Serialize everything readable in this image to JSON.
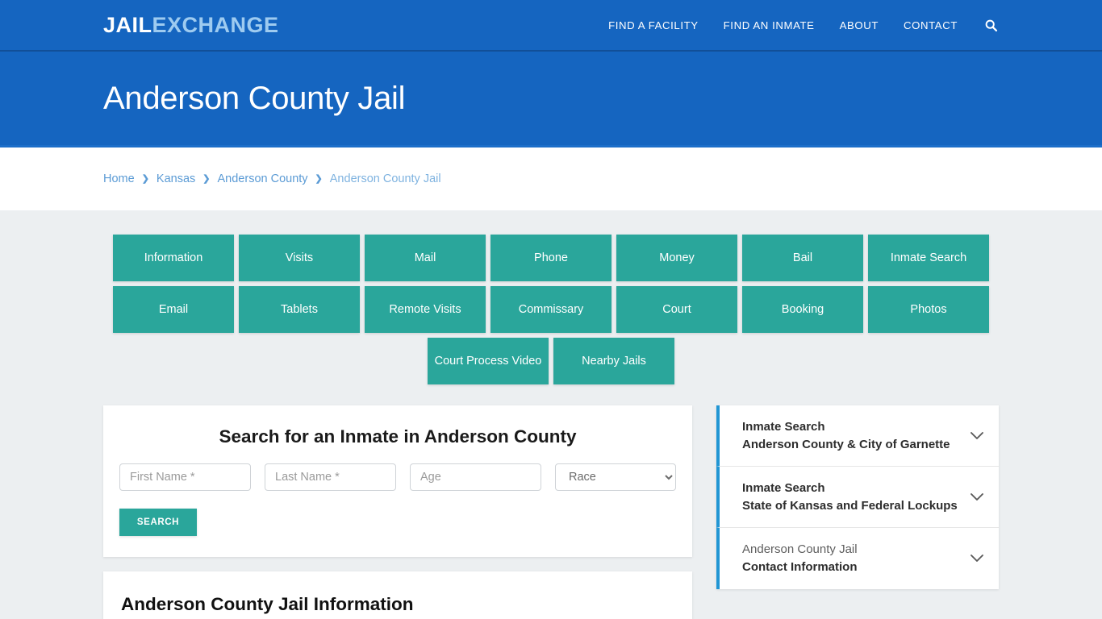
{
  "header": {
    "logo_primary": "JAIL",
    "logo_secondary": "EXCHANGE",
    "nav": [
      {
        "label": "FIND A FACILITY"
      },
      {
        "label": "FIND AN INMATE"
      },
      {
        "label": "ABOUT"
      },
      {
        "label": "CONTACT"
      }
    ],
    "search_icon": "search-icon",
    "brand_blue": "#1565c0"
  },
  "hero": {
    "title": "Anderson County Jail"
  },
  "breadcrumb": {
    "separator": "›",
    "items": [
      {
        "label": "Home"
      },
      {
        "label": "Kansas"
      },
      {
        "label": "Anderson County"
      },
      {
        "label": "Anderson County Jail"
      }
    ]
  },
  "nav_buttons": {
    "accent_teal": "#2aa69b",
    "row1": [
      {
        "label": "Information"
      },
      {
        "label": "Visits"
      },
      {
        "label": "Mail"
      },
      {
        "label": "Phone"
      },
      {
        "label": "Money"
      },
      {
        "label": "Bail"
      },
      {
        "label": "Inmate Search"
      }
    ],
    "row2": [
      {
        "label": "Email"
      },
      {
        "label": "Tablets"
      },
      {
        "label": "Remote Visits"
      },
      {
        "label": "Commissary"
      },
      {
        "label": "Court"
      },
      {
        "label": "Booking"
      },
      {
        "label": "Photos"
      }
    ],
    "row3": [
      {
        "label": "Court Process Video"
      },
      {
        "label": "Nearby Jails"
      }
    ]
  },
  "search_form": {
    "title": "Search for an Inmate in Anderson County",
    "first_name_placeholder": "First Name *",
    "first_name_value": "",
    "last_name_placeholder": "Last Name *",
    "last_name_value": "",
    "age_placeholder": "Age",
    "age_value": "",
    "race_selected": "Race",
    "race_options": [
      "Race"
    ],
    "submit_label": "SEARCH"
  },
  "info_section": {
    "heading": "Anderson County Jail Information"
  },
  "sidebar": {
    "accent_blue": "#2196d4",
    "panels": [
      {
        "line1": "Inmate Search",
        "line2": "Anderson County & City of Garnette",
        "line1_bold": true,
        "chevron": "chevron-down-icon"
      },
      {
        "line1": "Inmate Search",
        "line2": "State of Kansas and Federal Lockups",
        "line1_bold": true,
        "chevron": "chevron-down-icon"
      },
      {
        "line1": "Anderson County Jail",
        "line2": "Contact Information",
        "line1_bold": false,
        "chevron": "chevron-down-icon"
      }
    ]
  }
}
